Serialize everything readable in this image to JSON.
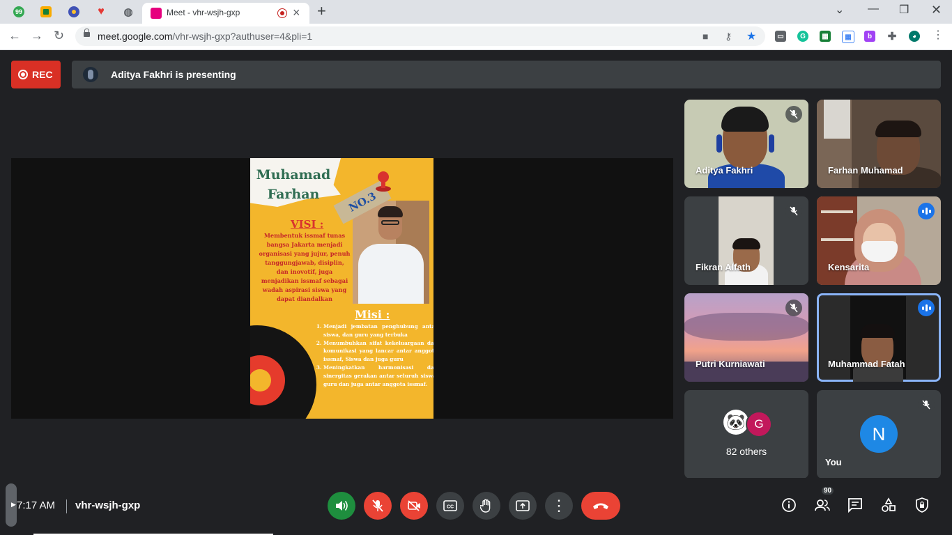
{
  "browser": {
    "pinned_tabs": [
      {
        "icon": "pinned-tab-99-icon",
        "label": "99",
        "color": "#34a853"
      },
      {
        "icon": "pinned-tab-classroom-icon",
        "label": "",
        "color": "#f9ab00"
      },
      {
        "icon": "pinned-tab-school-icon",
        "label": "",
        "color": "#3f51b5"
      },
      {
        "icon": "pinned-tab-heart-icon",
        "label": "",
        "color": "#e53935"
      },
      {
        "icon": "pinned-tab-globe-icon",
        "label": "",
        "color": "#5f6368"
      }
    ],
    "active_tab": {
      "title": "Meet - vhr-wsjh-gxp"
    },
    "url_host": "meet.google.com",
    "url_path": "/vhr-wsjh-gxp?authuser=4&pli=1"
  },
  "meet": {
    "rec_label": "REC",
    "presenting_text": "Aditya Fakhri is presenting",
    "poster": {
      "name_line1": "Muhamad",
      "name_line2": "Farhan",
      "number": "NO.3",
      "visi_title": "VISI :",
      "visi_text": "Membentuk issmaf tunas bangsa Jakarta menjadi organisasi yang jujur, penuh tanggungjawab, disiplin, dan inovotif, juga menjadikan issmaf sebagai wadah aspirasi siswa yang dapat diandalkan",
      "misi_title": "Misi :",
      "misi_items": [
        "Menjadi jembatan penghubung antar siswa, dan guru yang terbuka",
        "Menumbuhkan sifat kekeluargaan dan komunikasi yang lancar antar anggota issmaf, Siswa dan juga guru",
        "Meningkatkan harmonisasi dan sinergitas gerakan antar seluruh siswa, guru dan juga antar anggota issmaf."
      ]
    },
    "participants": [
      {
        "name": "Aditya Fakhri",
        "status": "muted"
      },
      {
        "name": "Farhan Muhamad",
        "status": "none"
      },
      {
        "name": "Fikran Alfath",
        "status": "muted"
      },
      {
        "name": "Kensarita",
        "status": "speaking"
      },
      {
        "name": "Putri Kurniawati",
        "status": "muted"
      },
      {
        "name": "Muhammad Fatah",
        "status": "speaking"
      }
    ],
    "others": {
      "avatar_letter": "G",
      "label": "82 others"
    },
    "you": {
      "avatar_letter": "N",
      "label": "You"
    },
    "bottom": {
      "time": "7:17 AM",
      "meeting_code": "vhr-wsjh-gxp",
      "people_count": "90"
    },
    "colors": {
      "rec": "#d93025",
      "hangup": "#ea4335",
      "speaking": "#1a73e8",
      "volume": "#1e8e3e"
    }
  }
}
